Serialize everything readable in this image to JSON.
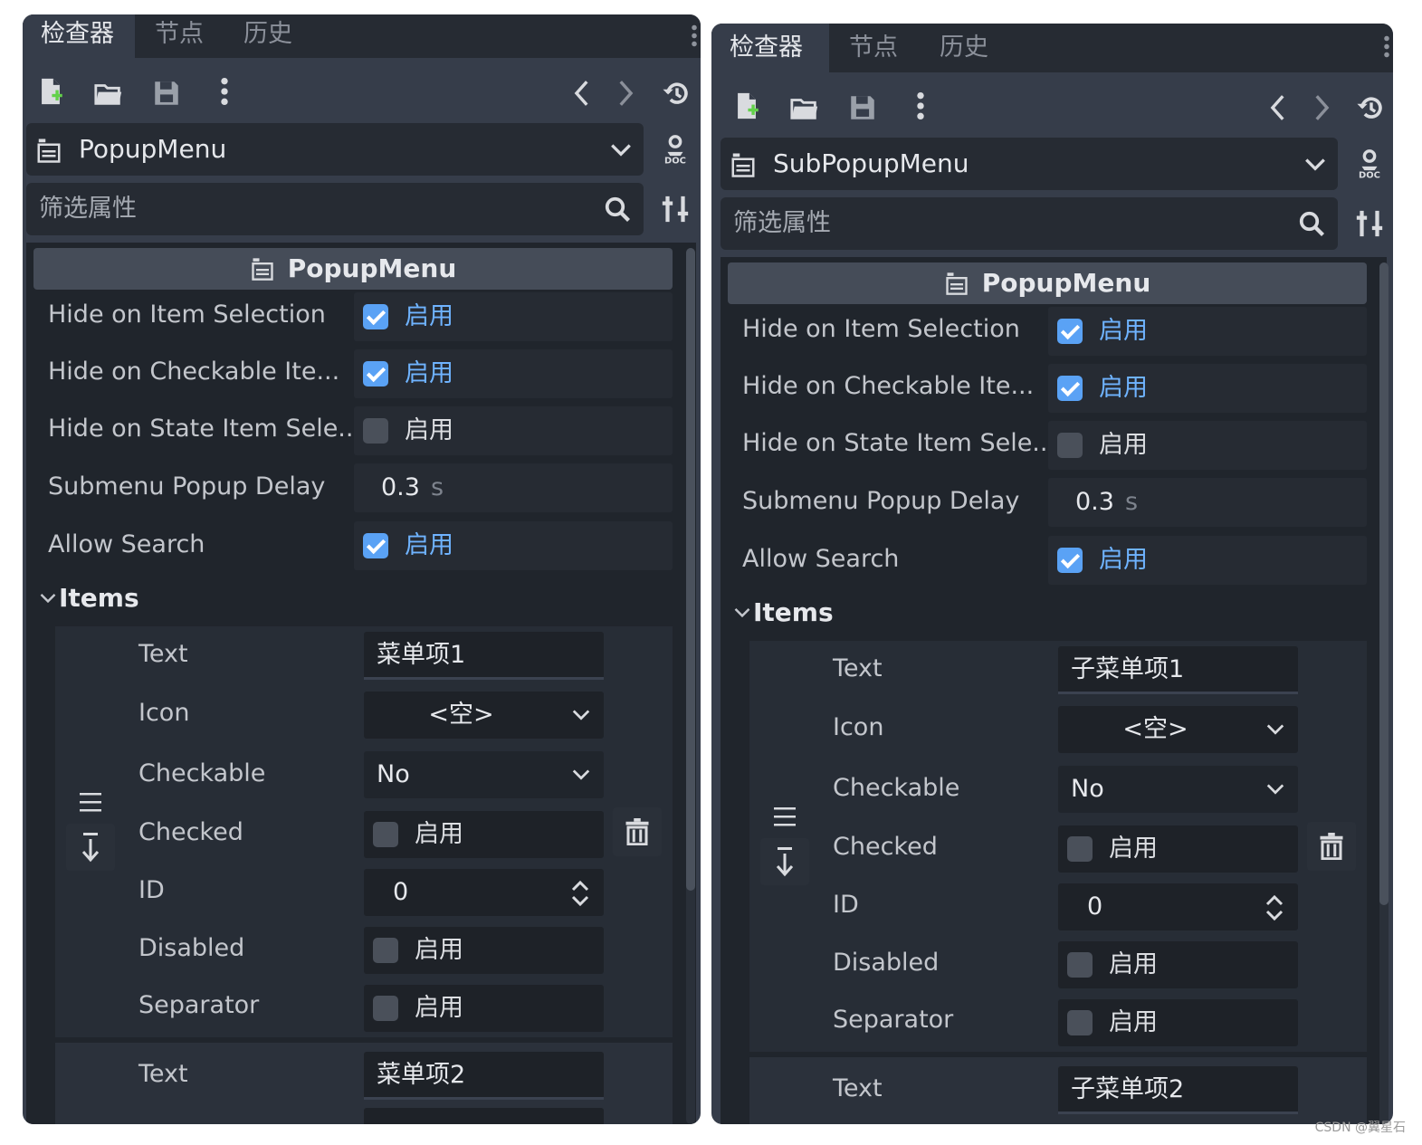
{
  "tabs": [
    "检查器",
    "节点",
    "历史"
  ],
  "filter_placeholder": "筛选属性",
  "left": {
    "node_name": "PopupMenu",
    "section_title": "PopupMenu",
    "props": [
      {
        "label": "Hide on Item Selection",
        "checked": true,
        "value": "启用"
      },
      {
        "label": "Hide on Checkable Ite...",
        "checked": true,
        "value": "启用"
      },
      {
        "label": "Hide on State Item Sele...",
        "checked": false,
        "value": "启用"
      }
    ],
    "delay_label": "Submenu Popup Delay",
    "delay_value": "0.3",
    "delay_unit": "s",
    "allow_search_label": "Allow Search",
    "allow_search_value": "启用",
    "items_title": "Items",
    "item1": {
      "text_label": "Text",
      "text_value": "菜单项1",
      "icon_label": "Icon",
      "icon_value": "<空>",
      "checkable_label": "Checkable",
      "checkable_value": "No",
      "checked_label": "Checked",
      "checked_value": "启用",
      "id_label": "ID",
      "id_value": "0",
      "disabled_label": "Disabled",
      "disabled_value": "启用",
      "separator_label": "Separator",
      "separator_value": "启用"
    },
    "item2": {
      "text_label": "Text",
      "text_value": "菜单项2"
    }
  },
  "right": {
    "node_name": "SubPopupMenu",
    "section_title": "PopupMenu",
    "props": [
      {
        "label": "Hide on Item Selection",
        "checked": true,
        "value": "启用"
      },
      {
        "label": "Hide on Checkable Ite...",
        "checked": true,
        "value": "启用"
      },
      {
        "label": "Hide on State Item Sele...",
        "checked": false,
        "value": "启用"
      }
    ],
    "delay_label": "Submenu Popup Delay",
    "delay_value": "0.3",
    "delay_unit": "s",
    "allow_search_label": "Allow Search",
    "allow_search_value": "启用",
    "items_title": "Items",
    "item1": {
      "text_label": "Text",
      "text_value": "子菜单项1",
      "icon_label": "Icon",
      "icon_value": "<空>",
      "checkable_label": "Checkable",
      "checkable_value": "No",
      "checked_label": "Checked",
      "checked_value": "启用",
      "id_label": "ID",
      "id_value": "0",
      "disabled_label": "Disabled",
      "disabled_value": "启用",
      "separator_label": "Separator",
      "separator_value": "启用"
    },
    "item2": {
      "text_label": "Text",
      "text_value": "子菜单项2"
    }
  },
  "watermark": "CSDN @翼星石",
  "colors": {
    "accent": "#5aa2f5",
    "panel": "#363d4a",
    "field": "#262b33"
  }
}
